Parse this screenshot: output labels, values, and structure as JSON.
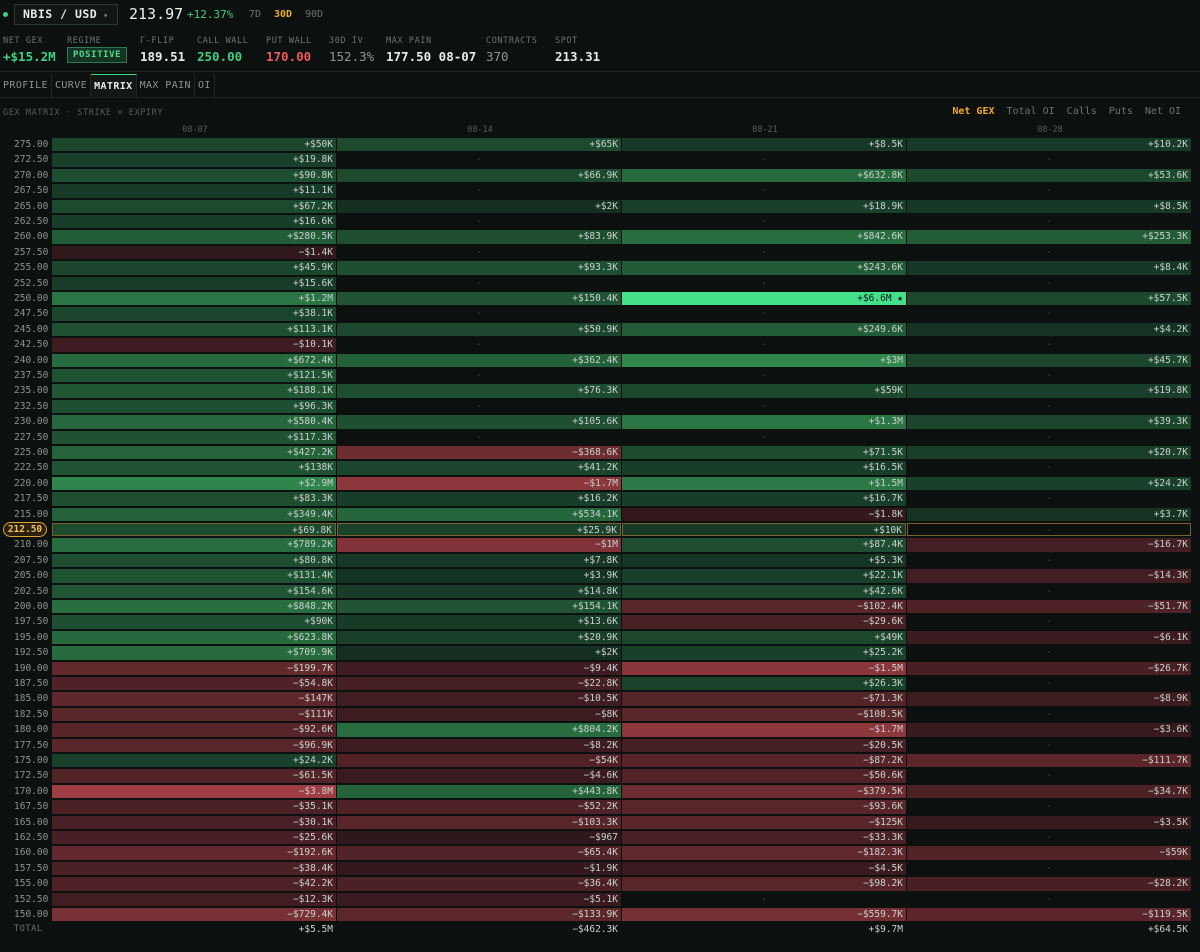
{
  "header": {
    "symbol": "NBIS / USD",
    "symbol_chevron": "▾",
    "price": "213.97",
    "change": "+12.37%",
    "ranges": [
      {
        "label": "7D",
        "active": false
      },
      {
        "label": "30D",
        "active": true
      },
      {
        "label": "90D",
        "active": false
      }
    ]
  },
  "stats": {
    "net_gex": {
      "label": "NET GEX",
      "value": "+$15.2M"
    },
    "regime": {
      "label": "REGIME",
      "value": "POSITIVE"
    },
    "gamma_flip": {
      "label": "Γ-FLIP",
      "value": "189.51"
    },
    "call_wall": {
      "label": "CALL WALL",
      "value": "250.00"
    },
    "put_wall": {
      "label": "PUT WALL",
      "value": "170.00"
    },
    "iv_30d": {
      "label": "30D IV",
      "value": "152.3%"
    },
    "max_pain": {
      "label": "MAX PAIN",
      "value": "177.50 08-07"
    },
    "contracts": {
      "label": "CONTRACTS",
      "value": "370"
    },
    "spot": {
      "label": "SPOT",
      "value": "213.31"
    }
  },
  "tabs": [
    {
      "label": "PROFILE",
      "active": false
    },
    {
      "label": "CURVE",
      "active": false
    },
    {
      "label": "MATRIX",
      "active": true
    },
    {
      "label": "MAX PAIN",
      "active": false
    },
    {
      "label": "OI",
      "active": false
    }
  ],
  "matrix": {
    "title": "GEX MATRIX · STRIKE × EXPIRY",
    "modes": [
      {
        "label": "Net GEX",
        "active": true
      },
      {
        "label": "Total OI",
        "active": false
      },
      {
        "label": "Calls",
        "active": false
      },
      {
        "label": "Puts",
        "active": false
      },
      {
        "label": "Net OI",
        "active": false
      }
    ],
    "expiries": [
      "08-07",
      "08-14",
      "08-21",
      "08-28"
    ],
    "spot_strike": "212.50",
    "max_marker": "★",
    "rows": [
      {
        "strike": "275.00",
        "cells": [
          "+$50K",
          "+$65K",
          "+$8.5K",
          "+$10.2K"
        ]
      },
      {
        "strike": "272.50",
        "cells": [
          "+$19.8K",
          "-",
          "-",
          "-"
        ]
      },
      {
        "strike": "270.00",
        "cells": [
          "+$90.8K",
          "+$66.9K",
          "+$632.8K",
          "+$53.6K"
        ]
      },
      {
        "strike": "267.50",
        "cells": [
          "+$11.1K",
          "-",
          "-",
          "-"
        ]
      },
      {
        "strike": "265.00",
        "cells": [
          "+$67.2K",
          "+$2K",
          "+$18.9K",
          "+$8.5K"
        ]
      },
      {
        "strike": "262.50",
        "cells": [
          "+$16.6K",
          "-",
          "-",
          "-"
        ]
      },
      {
        "strike": "260.00",
        "cells": [
          "+$280.5K",
          "+$83.9K",
          "+$842.6K",
          "+$253.3K"
        ]
      },
      {
        "strike": "257.50",
        "cells": [
          "−$1.4K",
          "-",
          "-",
          "-"
        ]
      },
      {
        "strike": "255.00",
        "cells": [
          "+$45.9K",
          "+$93.3K",
          "+$243.6K",
          "+$8.4K"
        ]
      },
      {
        "strike": "252.50",
        "cells": [
          "+$15.6K",
          "-",
          "-",
          "-"
        ]
      },
      {
        "strike": "250.00",
        "cells": [
          "+$1.2M",
          "+$150.4K",
          "+$6.6M",
          "+$57.5K"
        ]
      },
      {
        "strike": "247.50",
        "cells": [
          "+$38.1K",
          "-",
          "-",
          "-"
        ]
      },
      {
        "strike": "245.00",
        "cells": [
          "+$113.1K",
          "+$50.9K",
          "+$249.6K",
          "+$4.2K"
        ]
      },
      {
        "strike": "242.50",
        "cells": [
          "−$10.1K",
          "-",
          "-",
          "-"
        ]
      },
      {
        "strike": "240.00",
        "cells": [
          "+$672.4K",
          "+$362.4K",
          "+$3M",
          "+$45.7K"
        ]
      },
      {
        "strike": "237.50",
        "cells": [
          "+$121.5K",
          "-",
          "-",
          "-"
        ]
      },
      {
        "strike": "235.00",
        "cells": [
          "+$188.1K",
          "+$76.3K",
          "+$59K",
          "+$19.8K"
        ]
      },
      {
        "strike": "232.50",
        "cells": [
          "+$96.3K",
          "-",
          "-",
          "-"
        ]
      },
      {
        "strike": "230.00",
        "cells": [
          "+$580.4K",
          "+$105.6K",
          "+$1.3M",
          "+$39.3K"
        ]
      },
      {
        "strike": "227.50",
        "cells": [
          "+$117.3K",
          "-",
          "-",
          "-"
        ]
      },
      {
        "strike": "225.00",
        "cells": [
          "+$427.2K",
          "−$368.6K",
          "+$71.5K",
          "+$20.7K"
        ]
      },
      {
        "strike": "222.50",
        "cells": [
          "+$138K",
          "+$41.2K",
          "+$16.5K",
          "-"
        ]
      },
      {
        "strike": "220.00",
        "cells": [
          "+$2.9M",
          "−$1.7M",
          "+$1.5M",
          "+$24.2K"
        ]
      },
      {
        "strike": "217.50",
        "cells": [
          "+$83.3K",
          "+$16.2K",
          "+$16.7K",
          "-"
        ]
      },
      {
        "strike": "215.00",
        "cells": [
          "+$349.4K",
          "+$534.1K",
          "−$1.8K",
          "+$3.7K"
        ]
      },
      {
        "strike": "212.50",
        "cells": [
          "+$69.8K",
          "+$25.9K",
          "+$10K",
          "-"
        ]
      },
      {
        "strike": "210.00",
        "cells": [
          "+$789.2K",
          "−$1M",
          "+$87.4K",
          "−$16.7K"
        ]
      },
      {
        "strike": "207.50",
        "cells": [
          "+$80.8K",
          "+$7.8K",
          "+$5.3K",
          "-"
        ]
      },
      {
        "strike": "205.00",
        "cells": [
          "+$131.4K",
          "+$3.9K",
          "+$22.1K",
          "−$14.3K"
        ]
      },
      {
        "strike": "202.50",
        "cells": [
          "+$154.6K",
          "+$14.8K",
          "+$42.6K",
          "-"
        ]
      },
      {
        "strike": "200.00",
        "cells": [
          "+$848.2K",
          "+$154.1K",
          "−$102.4K",
          "−$51.7K"
        ]
      },
      {
        "strike": "197.50",
        "cells": [
          "+$90K",
          "+$13.6K",
          "−$29.6K",
          "-"
        ]
      },
      {
        "strike": "195.00",
        "cells": [
          "+$623.8K",
          "+$20.9K",
          "+$49K",
          "−$6.1K"
        ]
      },
      {
        "strike": "192.50",
        "cells": [
          "+$709.9K",
          "+$2K",
          "+$25.2K",
          "-"
        ]
      },
      {
        "strike": "190.00",
        "cells": [
          "−$199.7K",
          "−$9.4K",
          "−$1.5M",
          "−$26.7K"
        ]
      },
      {
        "strike": "187.50",
        "cells": [
          "−$54.8K",
          "−$22.8K",
          "+$26.3K",
          "-"
        ]
      },
      {
        "strike": "185.00",
        "cells": [
          "−$147K",
          "−$10.5K",
          "−$71.3K",
          "−$8.9K"
        ]
      },
      {
        "strike": "182.50",
        "cells": [
          "−$111K",
          "−$8K",
          "−$108.5K",
          "-"
        ]
      },
      {
        "strike": "180.00",
        "cells": [
          "−$92.6K",
          "+$804.2K",
          "−$1.7M",
          "−$3.6K"
        ]
      },
      {
        "strike": "177.50",
        "cells": [
          "−$96.9K",
          "−$8.2K",
          "−$20.5K",
          "-"
        ]
      },
      {
        "strike": "175.00",
        "cells": [
          "+$24.2K",
          "−$54K",
          "−$87.2K",
          "−$111.7K"
        ]
      },
      {
        "strike": "172.50",
        "cells": [
          "−$61.5K",
          "−$4.6K",
          "−$50.6K",
          "-"
        ]
      },
      {
        "strike": "170.00",
        "cells": [
          "−$3.8M",
          "+$443.8K",
          "−$379.5K",
          "−$34.7K"
        ]
      },
      {
        "strike": "167.50",
        "cells": [
          "−$35.1K",
          "−$52.2K",
          "−$93.6K",
          "-"
        ]
      },
      {
        "strike": "165.00",
        "cells": [
          "−$30.1K",
          "−$103.3K",
          "−$125K",
          "−$3.5K"
        ]
      },
      {
        "strike": "162.50",
        "cells": [
          "−$25.6K",
          "−$967",
          "−$33.3K",
          "-"
        ]
      },
      {
        "strike": "160.00",
        "cells": [
          "−$192.6K",
          "−$65.4K",
          "−$182.3K",
          "−$59K"
        ]
      },
      {
        "strike": "157.50",
        "cells": [
          "−$38.4K",
          "−$1.9K",
          "−$4.5K",
          "-"
        ]
      },
      {
        "strike": "155.00",
        "cells": [
          "−$42.2K",
          "−$36.4K",
          "−$98.2K",
          "−$28.2K"
        ]
      },
      {
        "strike": "152.50",
        "cells": [
          "−$12.3K",
          "−$5.1K",
          "-",
          "-"
        ]
      },
      {
        "strike": "150.00",
        "cells": [
          "−$729.4K",
          "−$133.9K",
          "−$559.7K",
          "−$119.5K"
        ]
      }
    ],
    "total": {
      "label": "TOTAL",
      "cells": [
        "+$5.5M",
        "−$462.3K",
        "+$9.7M",
        "+$64.5K"
      ]
    }
  },
  "colors": {
    "positive": "#3fcf86",
    "negative": "#ef5b5b",
    "accent": "#f0a830",
    "background": "#0c110f"
  }
}
